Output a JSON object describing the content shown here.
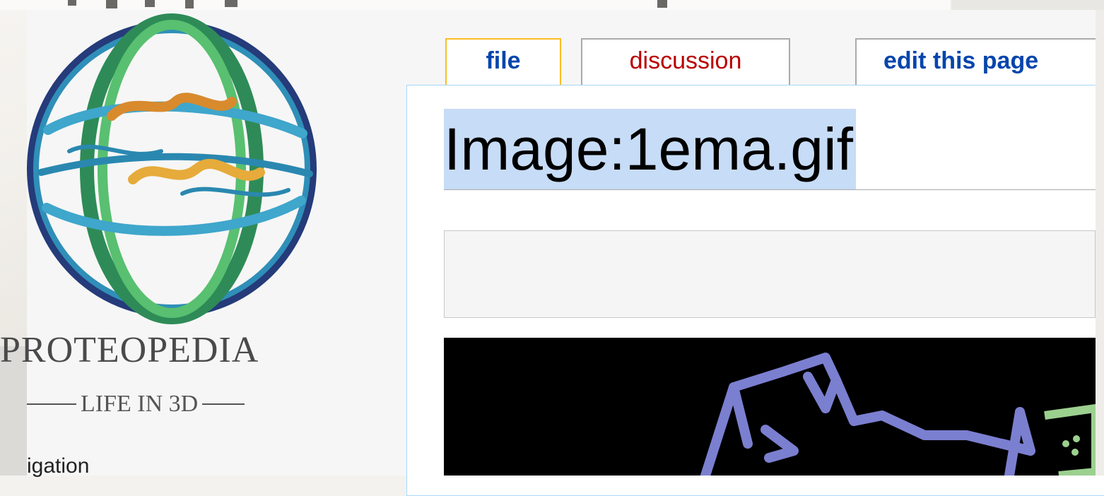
{
  "logo": {
    "wordmark": "PROTEOPEDIA",
    "tagline": "LIFE IN 3D"
  },
  "navigation": {
    "heading_fragment": "igation"
  },
  "tabs": [
    {
      "label": "file",
      "state": "selected"
    },
    {
      "label": "discussion",
      "state": "new"
    },
    {
      "label": "edit this page",
      "state": "default"
    }
  ],
  "page": {
    "title": "Image:1ema.gif",
    "title_selected": true
  },
  "colors": {
    "link": "#0645ad",
    "new_link": "#ba0000",
    "selection": "#c7dcf6",
    "selected_tab_border": "#fabd23",
    "content_border": "#a7d7f9",
    "molecule_blue": "#7b7fd0",
    "molecule_green": "#9cd08f"
  },
  "icons": {
    "logo": "proteopedia-globe-logo",
    "image": "1ema-molecule-structure"
  }
}
